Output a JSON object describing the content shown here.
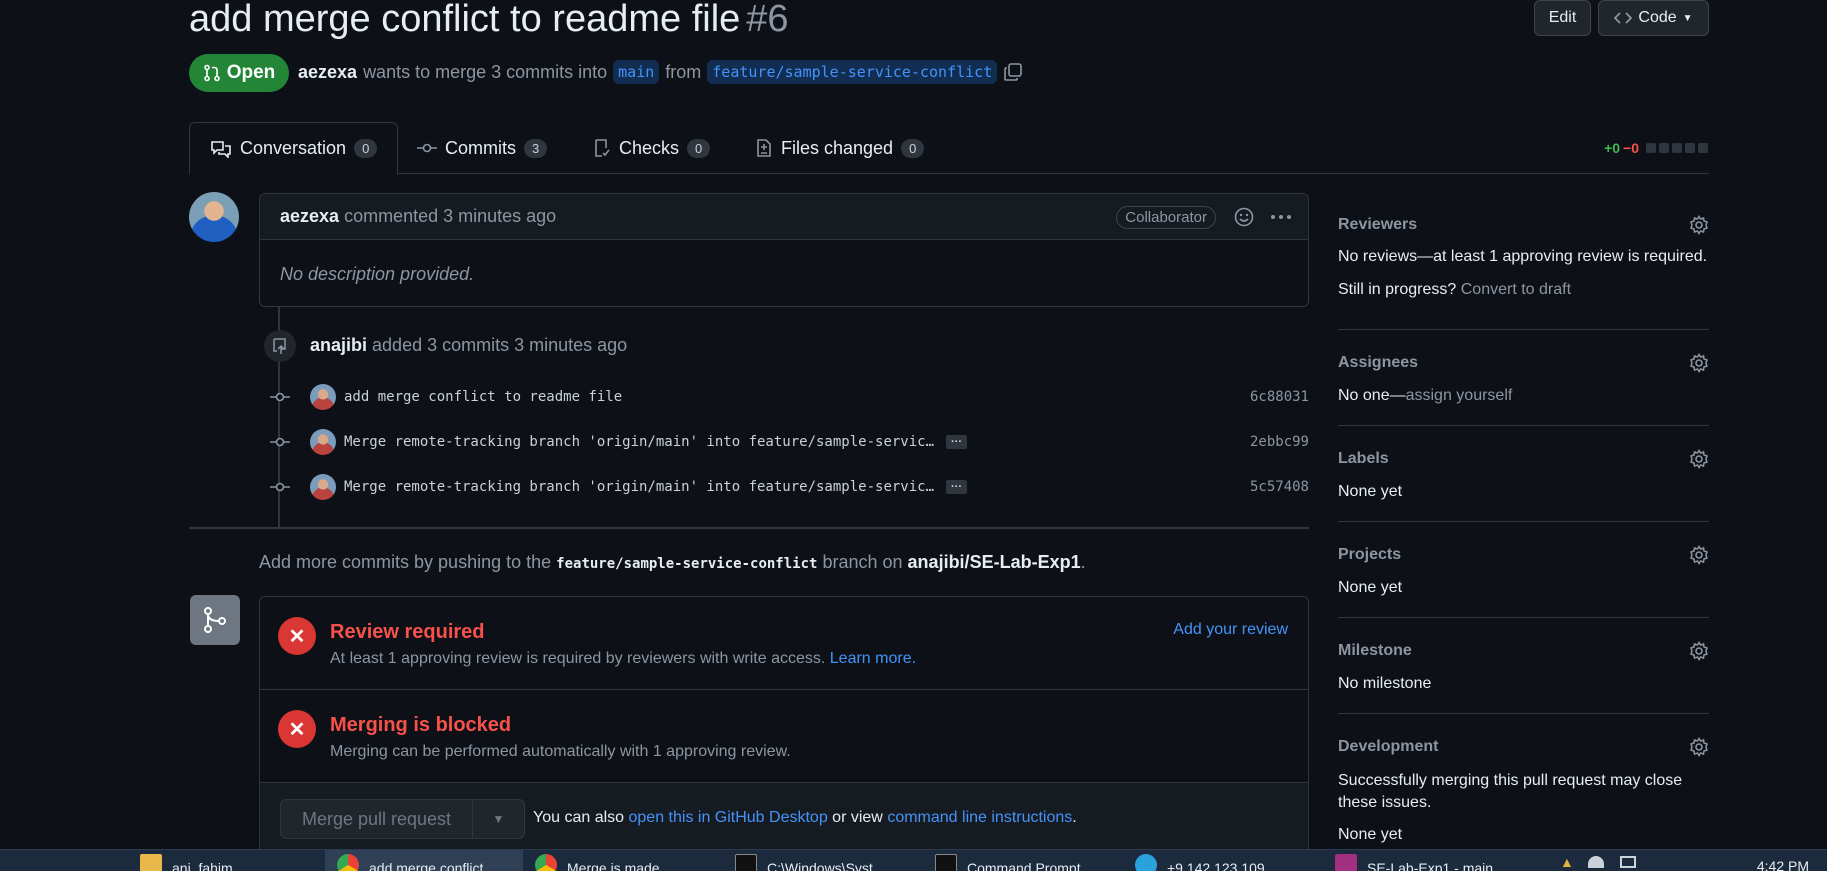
{
  "header": {
    "title": "add merge conflict to readme file",
    "number": "#6",
    "edit_label": "Edit",
    "code_label": "Code"
  },
  "pr_meta": {
    "state": "Open",
    "author": "aezexa",
    "summary": "wants to merge 3 commits into",
    "base_branch": "main",
    "from_label": "from",
    "head_branch": "feature/sample-service-conflict"
  },
  "tabs": [
    {
      "label": "Conversation",
      "count": "0"
    },
    {
      "label": "Commits",
      "count": "3"
    },
    {
      "label": "Checks",
      "count": "0"
    },
    {
      "label": "Files changed",
      "count": "0"
    }
  ],
  "diffstat": {
    "additions": "+0",
    "deletions": "−0"
  },
  "comment": {
    "author": "aezexa",
    "action": "commented 3 minutes ago",
    "role": "Collaborator",
    "body": "No description provided."
  },
  "timeline": {
    "actor": "anajibi",
    "action": "added 3 commits 3 minutes ago",
    "commits": [
      {
        "message": "add merge conflict to readme file",
        "sha": "6c88031"
      },
      {
        "message": "Merge remote-tracking branch 'origin/main' into feature/sample-servic…",
        "sha": "2ebbc99"
      },
      {
        "message": "Merge remote-tracking branch 'origin/main' into feature/sample-servic…",
        "sha": "5c57408"
      }
    ],
    "ellipsis": "···"
  },
  "push_note": {
    "prefix": "Add more commits by pushing to the",
    "branch": "feature/sample-service-conflict",
    "middle": "branch on",
    "repo": "anajibi/SE-Lab-Exp1",
    "suffix": "."
  },
  "merge_box": {
    "review": {
      "title": "Review required",
      "desc": "At least 1 approving review is required by reviewers with write access.",
      "learn_more": "Learn more.",
      "action": "Add your review"
    },
    "blocked": {
      "title": "Merging is blocked",
      "desc": "Merging can be performed automatically with 1 approving review."
    },
    "merge_button": "Merge pull request",
    "footer": {
      "prefix": "You can also",
      "desktop_link": "open this in GitHub Desktop",
      "middle": "or view",
      "cli_link": "command line instructions",
      "suffix": "."
    }
  },
  "sidebar": {
    "reviewers": {
      "heading": "Reviewers",
      "text": "No reviews—at least 1 approving review is required.",
      "progress": "Still in progress?",
      "draft_link": "Convert to draft"
    },
    "assignees": {
      "heading": "Assignees",
      "text": "No one—",
      "assign_link": "assign yourself"
    },
    "labels": {
      "heading": "Labels",
      "text": "None yet"
    },
    "projects": {
      "heading": "Projects",
      "text": "None yet"
    },
    "milestone": {
      "heading": "Milestone",
      "text": "No milestone"
    },
    "development": {
      "heading": "Development",
      "text": "Successfully merging this pull request may close these issues.",
      "none": "None yet"
    }
  },
  "taskbar": {
    "items": [
      {
        "label": "ani_fahim"
      },
      {
        "label": "add merge conflict"
      },
      {
        "label": "Merge is made"
      },
      {
        "label": "C:\\Windows\\Syst"
      },
      {
        "label": "Command Prompt"
      },
      {
        "label": "+9 142 123 109"
      },
      {
        "label": "SE-Lab-Exp1 - main"
      }
    ],
    "clock": "4:42 PM"
  },
  "colors": {
    "background": "#0d1117",
    "open_green": "#238636",
    "danger_red": "#f85149",
    "link_blue": "#4493f8"
  }
}
